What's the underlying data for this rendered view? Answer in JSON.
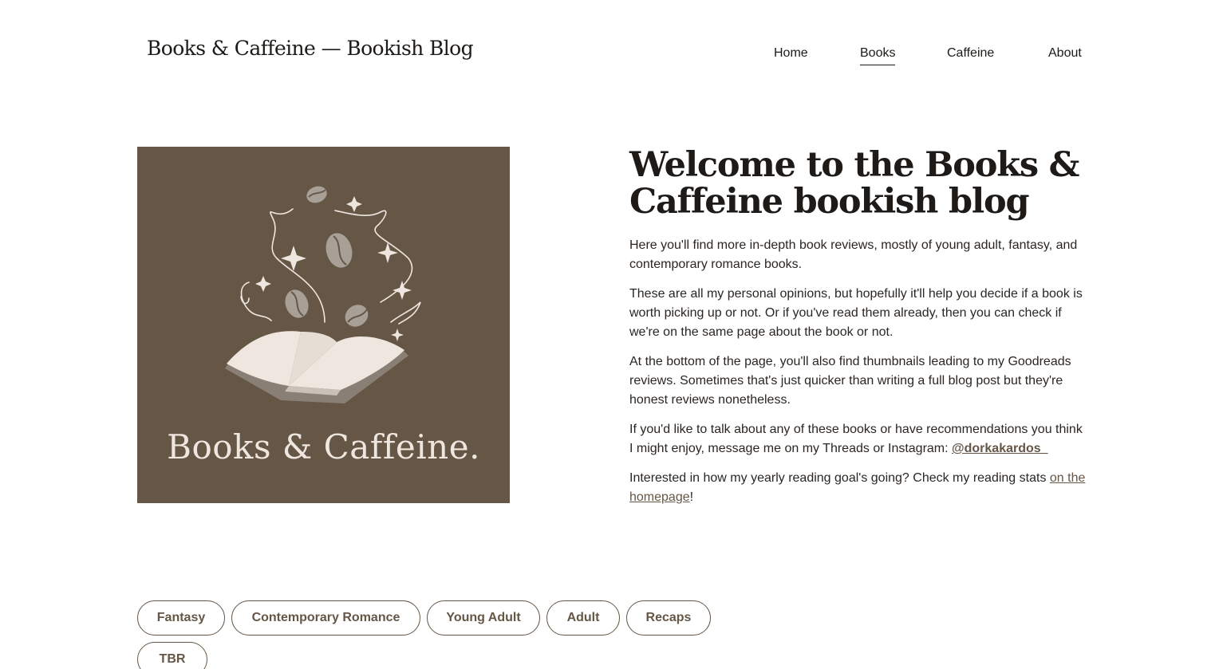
{
  "header": {
    "site_title": "Books & Caffeine — Bookish Blog",
    "nav": [
      "Home",
      "Books",
      "Caffeine",
      "About"
    ],
    "active_nav": "Books"
  },
  "hero": {
    "logo_text": "Books & Caffeine.",
    "colors": {
      "background": "#655646",
      "foreground": "#efe7df"
    },
    "icons": [
      "open-book-icon",
      "coffee-bean-icon",
      "sparkle-icon"
    ]
  },
  "main": {
    "headline": "Welcome to the Books & Caffeine bookish blog",
    "paragraphs": [
      "Here you'll find more in-depth book reviews, mostly of young adult, fantasy, and contemporary romance books.",
      "These are all my personal opinions, but hopefully it'll help you decide if a book is worth picking up or not. Or if you've read them already, then you can check if we're on the same page about the book or not.",
      "At the bottom of the page, you'll also find thumbnails leading to my Goodreads reviews. Sometimes that's just quicker than writing a full blog post but they're honest reviews nonetheless."
    ],
    "contact_text": "If you'd like to talk about any of these books or have recommendations you think I might enjoy, message me on my Threads or Instagram: ",
    "contact_handle": "@dorkakardos_",
    "stats_text": "Interested in how my yearly reading goal's going? Check my reading stats ",
    "stats_link": "on the homepage",
    "stats_suffix": "!"
  },
  "tags": [
    "Fantasy",
    "Contemporary Romance",
    "Young Adult",
    "Adult",
    "Recaps",
    "TBR"
  ],
  "colors": {
    "accent": "#655646",
    "text": "#1d1a17"
  }
}
